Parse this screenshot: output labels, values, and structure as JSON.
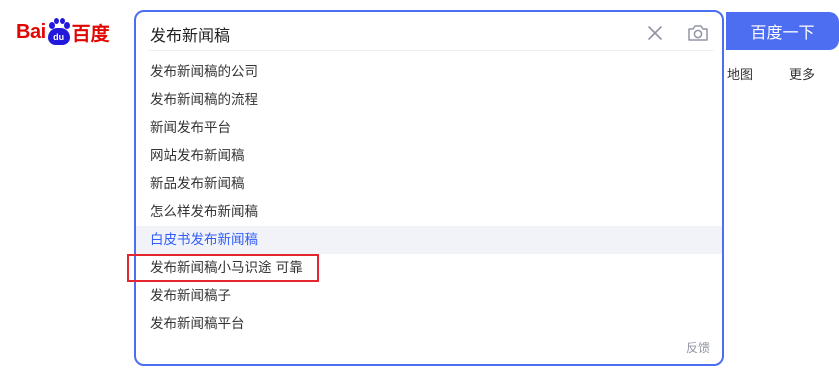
{
  "logo": {
    "latin": "Bai",
    "paw_text": "du",
    "chinese": "百度"
  },
  "search": {
    "value": "发布新闻稿"
  },
  "suggestions": [
    "发布新闻稿的公司",
    "发布新闻稿的流程",
    "新闻发布平台",
    "网站发布新闻稿",
    "新品发布新闻稿",
    "怎么样发布新闻稿",
    "白皮书发布新闻稿",
    "发布新闻稿小马识途 可靠",
    "发布新闻稿子",
    "发布新闻稿平台"
  ],
  "active_suggestion_index": 6,
  "feedback_label": "反馈",
  "search_button_label": "百度一下",
  "nav": {
    "map_label": "地图",
    "more_label": "更多"
  },
  "colors": {
    "accent": "#4e6ef2",
    "logo_red": "#e10601",
    "logo_blue": "#2319dc",
    "highlight_red": "#e3262f",
    "active_text": "#315efb"
  },
  "icons": {
    "clear": "close-icon",
    "camera": "camera-icon"
  }
}
